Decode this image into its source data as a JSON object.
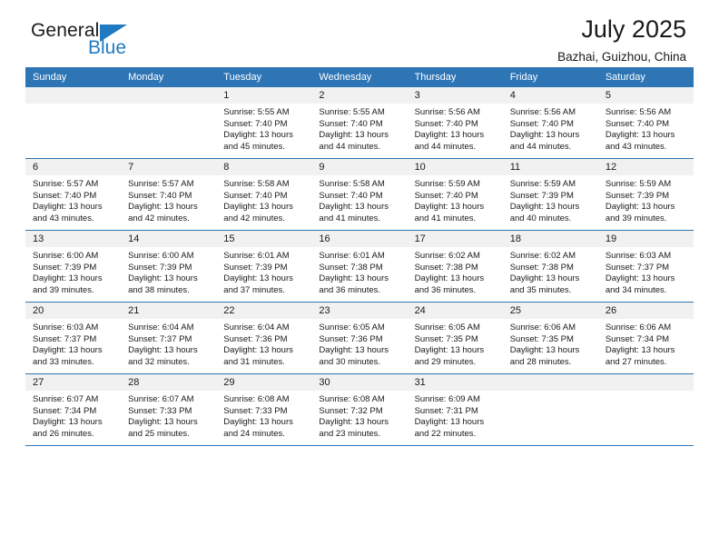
{
  "brand": {
    "line1": "General",
    "line2": "Blue",
    "triangle_icon": "blue-triangle-icon",
    "color_dark": "#1b1b1b",
    "color_blue": "#1f7ac1"
  },
  "header": {
    "title": "July 2025",
    "subtitle": "Bazhai, Guizhou, China"
  },
  "theme": {
    "header_blue": "#2e75b6",
    "daynum_band": "#f1f1f1",
    "text": "#1a1a1a"
  },
  "weekdays": [
    "Sunday",
    "Monday",
    "Tuesday",
    "Wednesday",
    "Thursday",
    "Friday",
    "Saturday"
  ],
  "labels": {
    "sunrise": "Sunrise:",
    "sunset": "Sunset:",
    "daylight": "Daylight:"
  },
  "weeks": [
    [
      {
        "day": "",
        "empty": true
      },
      {
        "day": "",
        "empty": true
      },
      {
        "day": "1",
        "sunrise": "Sunrise: 5:55 AM",
        "sunset": "Sunset: 7:40 PM",
        "daylight": "Daylight: 13 hours and 45 minutes."
      },
      {
        "day": "2",
        "sunrise": "Sunrise: 5:55 AM",
        "sunset": "Sunset: 7:40 PM",
        "daylight": "Daylight: 13 hours and 44 minutes."
      },
      {
        "day": "3",
        "sunrise": "Sunrise: 5:56 AM",
        "sunset": "Sunset: 7:40 PM",
        "daylight": "Daylight: 13 hours and 44 minutes."
      },
      {
        "day": "4",
        "sunrise": "Sunrise: 5:56 AM",
        "sunset": "Sunset: 7:40 PM",
        "daylight": "Daylight: 13 hours and 44 minutes."
      },
      {
        "day": "5",
        "sunrise": "Sunrise: 5:56 AM",
        "sunset": "Sunset: 7:40 PM",
        "daylight": "Daylight: 13 hours and 43 minutes."
      }
    ],
    [
      {
        "day": "6",
        "sunrise": "Sunrise: 5:57 AM",
        "sunset": "Sunset: 7:40 PM",
        "daylight": "Daylight: 13 hours and 43 minutes."
      },
      {
        "day": "7",
        "sunrise": "Sunrise: 5:57 AM",
        "sunset": "Sunset: 7:40 PM",
        "daylight": "Daylight: 13 hours and 42 minutes."
      },
      {
        "day": "8",
        "sunrise": "Sunrise: 5:58 AM",
        "sunset": "Sunset: 7:40 PM",
        "daylight": "Daylight: 13 hours and 42 minutes."
      },
      {
        "day": "9",
        "sunrise": "Sunrise: 5:58 AM",
        "sunset": "Sunset: 7:40 PM",
        "daylight": "Daylight: 13 hours and 41 minutes."
      },
      {
        "day": "10",
        "sunrise": "Sunrise: 5:59 AM",
        "sunset": "Sunset: 7:40 PM",
        "daylight": "Daylight: 13 hours and 41 minutes."
      },
      {
        "day": "11",
        "sunrise": "Sunrise: 5:59 AM",
        "sunset": "Sunset: 7:39 PM",
        "daylight": "Daylight: 13 hours and 40 minutes."
      },
      {
        "day": "12",
        "sunrise": "Sunrise: 5:59 AM",
        "sunset": "Sunset: 7:39 PM",
        "daylight": "Daylight: 13 hours and 39 minutes."
      }
    ],
    [
      {
        "day": "13",
        "sunrise": "Sunrise: 6:00 AM",
        "sunset": "Sunset: 7:39 PM",
        "daylight": "Daylight: 13 hours and 39 minutes."
      },
      {
        "day": "14",
        "sunrise": "Sunrise: 6:00 AM",
        "sunset": "Sunset: 7:39 PM",
        "daylight": "Daylight: 13 hours and 38 minutes."
      },
      {
        "day": "15",
        "sunrise": "Sunrise: 6:01 AM",
        "sunset": "Sunset: 7:39 PM",
        "daylight": "Daylight: 13 hours and 37 minutes."
      },
      {
        "day": "16",
        "sunrise": "Sunrise: 6:01 AM",
        "sunset": "Sunset: 7:38 PM",
        "daylight": "Daylight: 13 hours and 36 minutes."
      },
      {
        "day": "17",
        "sunrise": "Sunrise: 6:02 AM",
        "sunset": "Sunset: 7:38 PM",
        "daylight": "Daylight: 13 hours and 36 minutes."
      },
      {
        "day": "18",
        "sunrise": "Sunrise: 6:02 AM",
        "sunset": "Sunset: 7:38 PM",
        "daylight": "Daylight: 13 hours and 35 minutes."
      },
      {
        "day": "19",
        "sunrise": "Sunrise: 6:03 AM",
        "sunset": "Sunset: 7:37 PM",
        "daylight": "Daylight: 13 hours and 34 minutes."
      }
    ],
    [
      {
        "day": "20",
        "sunrise": "Sunrise: 6:03 AM",
        "sunset": "Sunset: 7:37 PM",
        "daylight": "Daylight: 13 hours and 33 minutes."
      },
      {
        "day": "21",
        "sunrise": "Sunrise: 6:04 AM",
        "sunset": "Sunset: 7:37 PM",
        "daylight": "Daylight: 13 hours and 32 minutes."
      },
      {
        "day": "22",
        "sunrise": "Sunrise: 6:04 AM",
        "sunset": "Sunset: 7:36 PM",
        "daylight": "Daylight: 13 hours and 31 minutes."
      },
      {
        "day": "23",
        "sunrise": "Sunrise: 6:05 AM",
        "sunset": "Sunset: 7:36 PM",
        "daylight": "Daylight: 13 hours and 30 minutes."
      },
      {
        "day": "24",
        "sunrise": "Sunrise: 6:05 AM",
        "sunset": "Sunset: 7:35 PM",
        "daylight": "Daylight: 13 hours and 29 minutes."
      },
      {
        "day": "25",
        "sunrise": "Sunrise: 6:06 AM",
        "sunset": "Sunset: 7:35 PM",
        "daylight": "Daylight: 13 hours and 28 minutes."
      },
      {
        "day": "26",
        "sunrise": "Sunrise: 6:06 AM",
        "sunset": "Sunset: 7:34 PM",
        "daylight": "Daylight: 13 hours and 27 minutes."
      }
    ],
    [
      {
        "day": "27",
        "sunrise": "Sunrise: 6:07 AM",
        "sunset": "Sunset: 7:34 PM",
        "daylight": "Daylight: 13 hours and 26 minutes."
      },
      {
        "day": "28",
        "sunrise": "Sunrise: 6:07 AM",
        "sunset": "Sunset: 7:33 PM",
        "daylight": "Daylight: 13 hours and 25 minutes."
      },
      {
        "day": "29",
        "sunrise": "Sunrise: 6:08 AM",
        "sunset": "Sunset: 7:33 PM",
        "daylight": "Daylight: 13 hours and 24 minutes."
      },
      {
        "day": "30",
        "sunrise": "Sunrise: 6:08 AM",
        "sunset": "Sunset: 7:32 PM",
        "daylight": "Daylight: 13 hours and 23 minutes."
      },
      {
        "day": "31",
        "sunrise": "Sunrise: 6:09 AM",
        "sunset": "Sunset: 7:31 PM",
        "daylight": "Daylight: 13 hours and 22 minutes."
      },
      {
        "day": "",
        "empty": true
      },
      {
        "day": "",
        "empty": true
      }
    ]
  ]
}
